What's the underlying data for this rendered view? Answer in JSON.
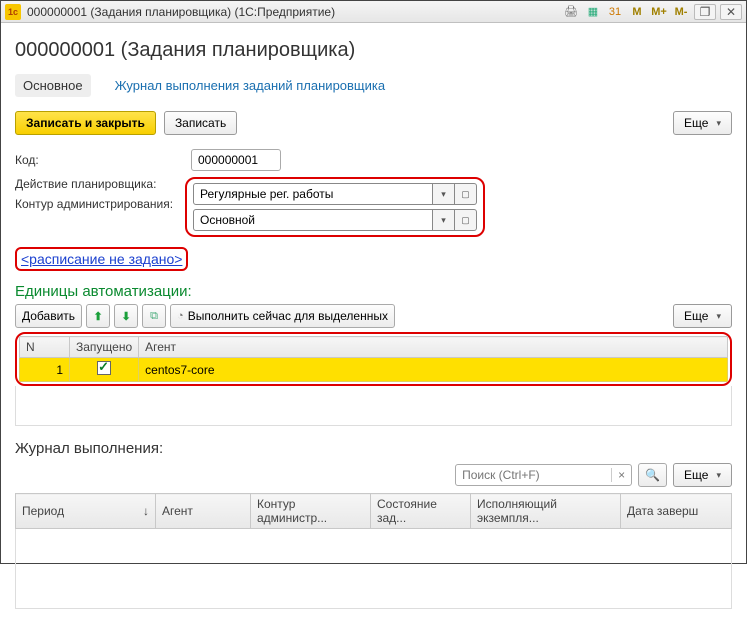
{
  "titlebar": {
    "text": "000000001 (Задания планировщика)  (1С:Предприятие)"
  },
  "header": {
    "title": "000000001 (Задания планировщика)"
  },
  "tabs": {
    "main": "Основное",
    "log_link": "Журнал выполнения заданий планировщика"
  },
  "buttons": {
    "save_close": "Записать и закрыть",
    "save": "Записать",
    "more": "Еще"
  },
  "form": {
    "code_label": "Код:",
    "code_value": "000000001",
    "action_label": "Действие планировщика:",
    "action_value": "Регулярные рег. работы",
    "contour_label": "Контур администрирования:",
    "contour_value": "Основной",
    "schedule_link": "<расписание не задано>"
  },
  "units": {
    "header": "Единицы автоматизации:",
    "add": "Добавить",
    "run_selected": "Выполнить сейчас для выделенных",
    "more": "Еще",
    "columns": {
      "n": "N",
      "started": "Запущено",
      "agent": "Агент"
    },
    "row": {
      "n": "1",
      "agent": "centos7-core"
    }
  },
  "log": {
    "header": "Журнал выполнения:",
    "search_placeholder": "Поиск (Ctrl+F)",
    "more": "Еще",
    "columns": {
      "period": "Период",
      "agent": "Агент",
      "contour": "Контур администр...",
      "state": "Состояние зад...",
      "executor": "Исполняющий экземпля...",
      "finished": "Дата заверш"
    }
  },
  "mem": {
    "m": "M",
    "mplus": "M+",
    "mminus": "M-"
  }
}
